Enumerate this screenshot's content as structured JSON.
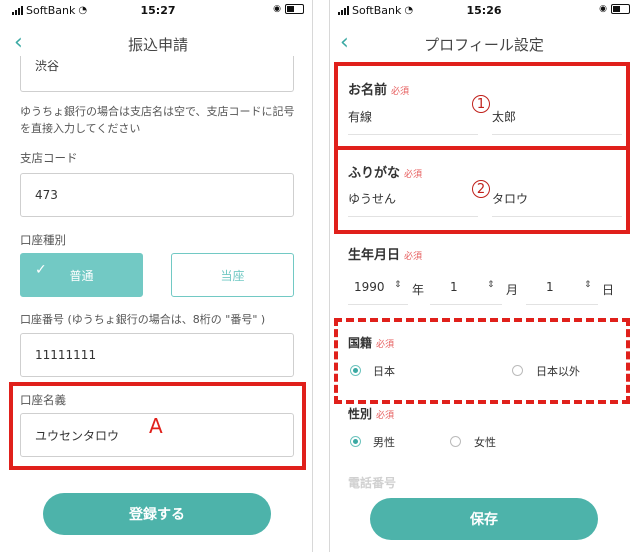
{
  "left": {
    "status": {
      "carrier": "SoftBank",
      "time": "15:27"
    },
    "title": "振込申請",
    "branch_name_value": "渋谷",
    "note": "ゆうちょ銀行の場合は支店名は空で、支店コードに記号を直接入力してください",
    "branch_code": {
      "label": "支店コード",
      "value": "473"
    },
    "account_type": {
      "label": "口座種別",
      "options": [
        "普通",
        "当座"
      ],
      "selected": "普通"
    },
    "account_number": {
      "label": "口座番号 (ゆうちょ銀行の場合は、8桁の \"番号\" )",
      "value": "11111111"
    },
    "account_holder": {
      "label": "口座名義",
      "value": "ユウセンタロウ"
    },
    "marker": "A",
    "submit_label": "登録する"
  },
  "right": {
    "status": {
      "carrier": "SoftBank",
      "time": "15:26"
    },
    "title": "プロフィール設定",
    "required_label": "必須",
    "name": {
      "label": "お名前",
      "last": "有線",
      "first": "太郎",
      "marker": "1"
    },
    "kana": {
      "label": "ふりがな",
      "last": "ゆうせん",
      "first": "タロウ",
      "marker": "2"
    },
    "birthday": {
      "label": "生年月日",
      "year": "1990",
      "year_unit": "年",
      "month": "1",
      "month_unit": "月",
      "day": "1",
      "day_unit": "日"
    },
    "nationality": {
      "label": "国籍",
      "options": [
        "日本",
        "日本以外"
      ],
      "selected": "日本"
    },
    "gender": {
      "label": "性別",
      "options": [
        "男性",
        "女性"
      ],
      "selected": "男性"
    },
    "next_label_partial": "電話番号",
    "save_label": "保存"
  },
  "colors": {
    "accent": "#4db3aa",
    "annotation": "#e0201b",
    "required": "#e65b5b"
  }
}
